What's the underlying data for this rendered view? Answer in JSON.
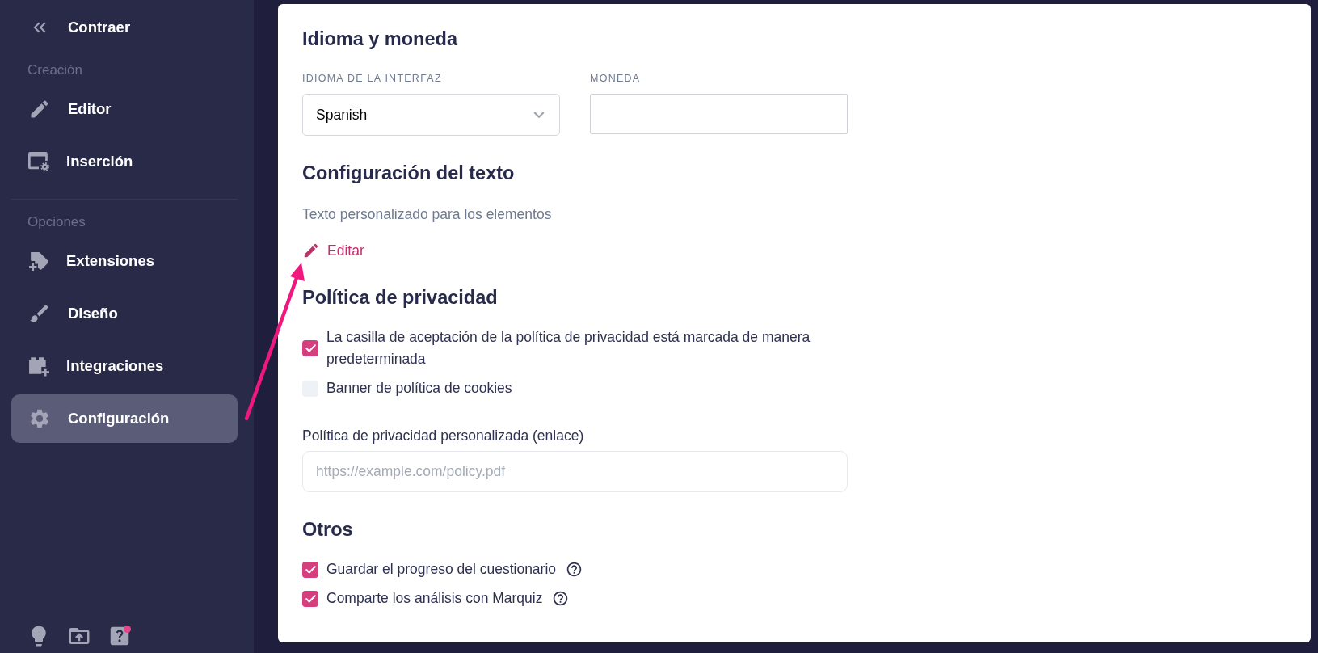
{
  "sidebar": {
    "collapse": {
      "label": "Contraer"
    },
    "groups": [
      {
        "title": "Creación",
        "items": [
          {
            "label": "Editor",
            "selected": false
          },
          {
            "label": "Inserción",
            "selected": false
          }
        ]
      },
      {
        "title": "Opciones",
        "items": [
          {
            "label": "Extensiones",
            "selected": false
          },
          {
            "label": "Diseño",
            "selected": false
          },
          {
            "label": "Integraciones",
            "selected": false
          },
          {
            "label": "Configuración",
            "selected": true
          }
        ]
      }
    ],
    "footer": {
      "help_notification": true
    }
  },
  "sections": [
    {
      "title": "Idioma y moneda",
      "items": [
        {
          "kind": "field_row",
          "fields": [
            {
              "kind": "select",
              "label": "IDIOMA DE LA INTERFAZ",
              "value": "Spanish"
            },
            {
              "kind": "input",
              "label": "MONEDA"
            }
          ]
        }
      ]
    },
    {
      "title": "Configuración del texto",
      "items": [
        {
          "kind": "text",
          "text": "Texto personalizado para los elementos"
        },
        {
          "kind": "link",
          "label": "Editar"
        }
      ]
    },
    {
      "title": "Política de privacidad",
      "items": [
        {
          "kind": "checkbox",
          "label": "La casilla de aceptación de la política de privacidad está marcada de manera predeterminada",
          "checked": true
        },
        {
          "kind": "checkbox",
          "label": "Banner de política de cookies",
          "checked": false
        },
        {
          "kind": "url_field",
          "label": "Política de privacidad personalizada (enlace)",
          "placeholder": "https://example.com/policy.pdf"
        }
      ]
    },
    {
      "title": "Otros",
      "items": [
        {
          "kind": "checkbox",
          "label": "Guardar el progreso del cuestionario",
          "checked": true,
          "help": true
        },
        {
          "kind": "checkbox",
          "label": "Comparte los análisis con Marquiz",
          "checked": true,
          "help": true
        }
      ]
    }
  ]
}
